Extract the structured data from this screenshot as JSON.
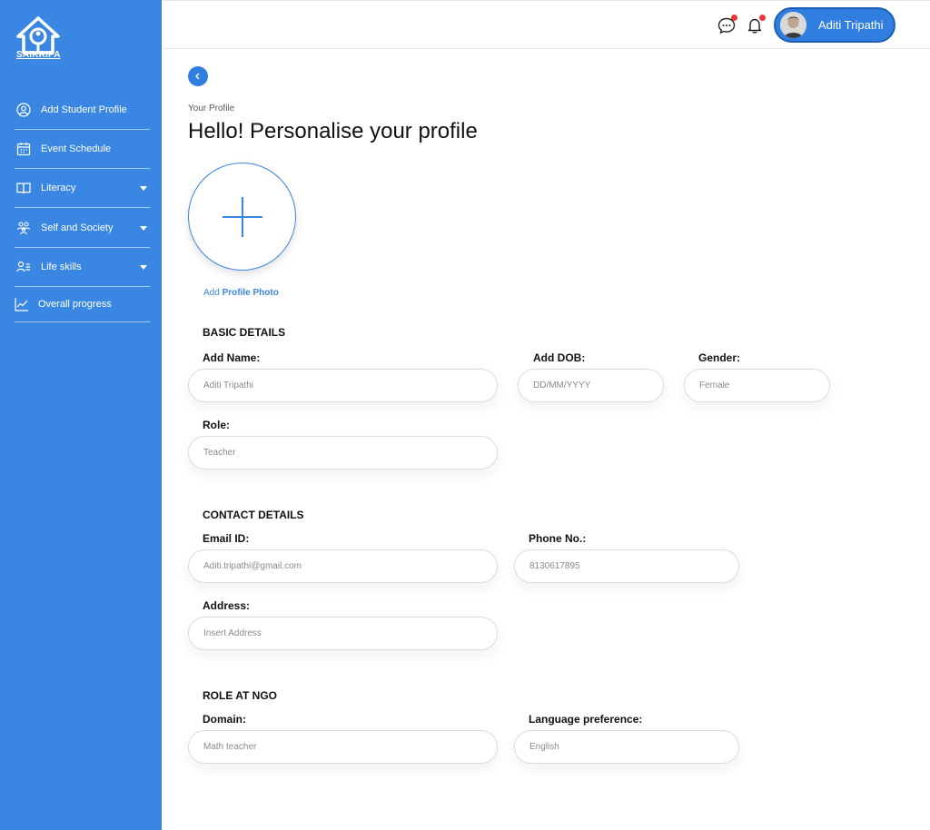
{
  "brand": {
    "name": "SAIKRIPA"
  },
  "sidebar": {
    "items": [
      {
        "label": "Add Student Profile",
        "icon": "user-circle-icon",
        "has_caret": false
      },
      {
        "label": "Event Schedule",
        "icon": "calendar-icon",
        "has_caret": false
      },
      {
        "label": "Literacy",
        "icon": "book-icon",
        "has_caret": true
      },
      {
        "label": "Self and Society",
        "icon": "people-group-icon",
        "has_caret": true
      },
      {
        "label": "Life skills",
        "icon": "user-list-icon",
        "has_caret": true
      },
      {
        "label": "Overall progress",
        "icon": "chart-line-icon",
        "has_caret": false
      }
    ]
  },
  "header": {
    "user_name": "Aditi Tripathi",
    "icons": [
      "chat-icon",
      "bell-icon"
    ]
  },
  "page": {
    "breadcrumb": "Your Profile",
    "title": "Hello! Personalise your profile",
    "add_photo_prefix": "Add",
    "add_photo_bold": "Profile Photo"
  },
  "basic": {
    "heading": "BASIC DETAILS",
    "name_label": "Add Name:",
    "name_placeholder": "Aditi Tripathi",
    "dob_label": "Add DOB:",
    "dob_placeholder": "DD/MM/YYYY",
    "gender_label": "Gender:",
    "gender_placeholder": "Female",
    "role_label": "Role:",
    "role_placeholder": "Teacher"
  },
  "contact": {
    "heading": "CONTACT DETAILS",
    "email_label": "Email ID:",
    "email_placeholder": "Aditi.tripathi@gmail.com",
    "phone_label": "Phone No.:",
    "phone_placeholder": "8130617895",
    "address_label": "Address:",
    "address_placeholder": "Insert Address"
  },
  "ngo": {
    "heading": "ROLE AT NGO",
    "domain_label": "Domain:",
    "domain_placeholder": "Math teacher",
    "language_label": "Language preference:",
    "language_placeholder": "English"
  },
  "colors": {
    "primary": "#3a86e3",
    "notification": "#e53935"
  }
}
